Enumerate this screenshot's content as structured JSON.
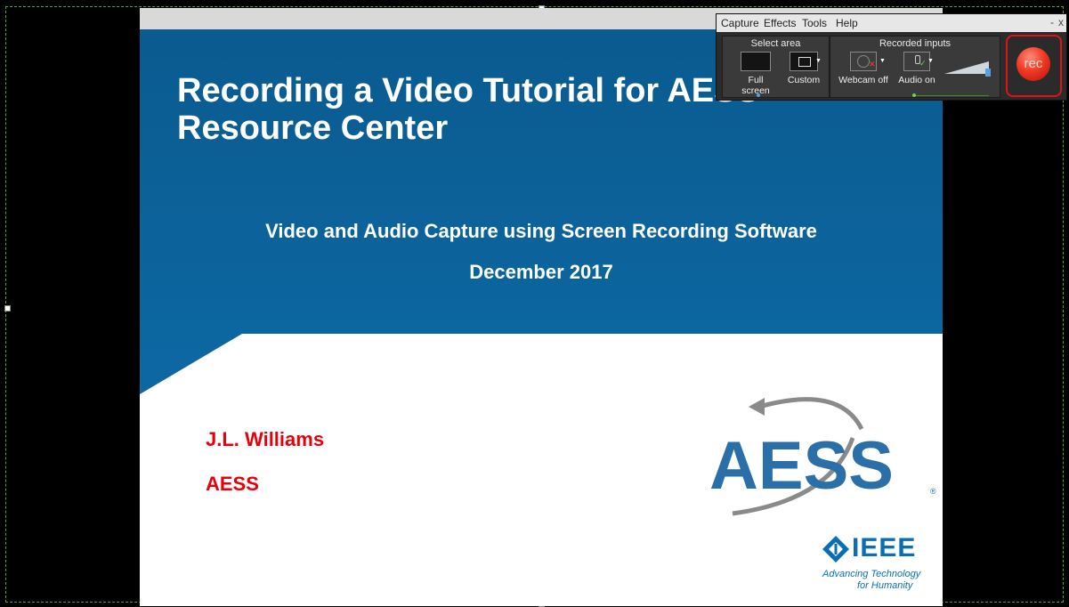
{
  "slide": {
    "title_line1": "Recording a Video Tutorial for AESS",
    "title_line2": "Resource Center",
    "subtitle": "Video and Audio Capture using Screen Recording Software",
    "date": "December 2017",
    "author": "J.L. Williams",
    "organization": "AESS",
    "aess_logo_text": "AESS",
    "ieee_logo_text": "IEEE",
    "ieee_tagline_1": "Advancing Technology",
    "ieee_tagline_2": "for Humanity",
    "colors": {
      "band": "#0b5f95",
      "accent_red": "#e8000b",
      "aess_blue": "#2a6fa8",
      "ieee_blue": "#0a6eb4"
    }
  },
  "recorder": {
    "menu": [
      "Capture",
      "Effects",
      "Tools",
      "Help"
    ],
    "window_controls": {
      "minimize": "-",
      "close": "x"
    },
    "select_area": {
      "title": "Select area",
      "full_screen_label": "Full screen",
      "custom_label": "Custom"
    },
    "recorded_inputs": {
      "title": "Recorded inputs",
      "webcam_label": "Webcam off",
      "audio_label": "Audio on",
      "audio_level": 0.85
    },
    "rec_button_label": "rec",
    "colors": {
      "rec_highlight": "#e0121a",
      "panel": "#2b2b2b"
    }
  }
}
